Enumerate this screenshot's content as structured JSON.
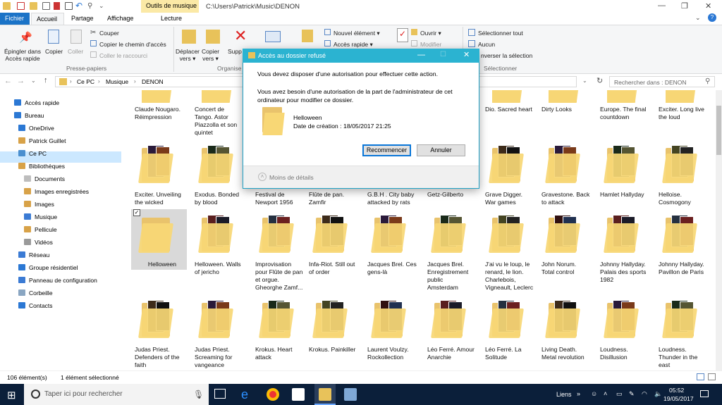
{
  "window": {
    "context_tab": "Outils de musique",
    "path_title": "C:\\Users\\Patrick\\Music\\DENON"
  },
  "tabs": [
    "Fichier",
    "Accueil",
    "Partage",
    "Affichage",
    "Lecture"
  ],
  "ribbon": {
    "pin": "Épingler dans\nAccès rapide",
    "copy": "Copier",
    "paste": "Coller",
    "cut": "Couper",
    "copy_path": "Copier le chemin d'accès",
    "paste_shortcut": "Coller le raccourci",
    "group_clipboard": "Presse-papiers",
    "move_to": "Déplacer\nvers ▾",
    "copy_to": "Copier\nvers ▾",
    "delete": "Supp",
    "group_organise": "Organise",
    "new_item": "Nouvel élément ▾",
    "easy_access": "Accès rapide ▾",
    "open": "Ouvrir ▾",
    "edit": "Modifier",
    "select_all": "Sélectionner tout",
    "select_none": "Aucun",
    "invert": "nverser la sélection",
    "group_select": "Sélectionner"
  },
  "address": {
    "crumbs": [
      "Ce PC",
      "Musique",
      "DENON"
    ],
    "search_placeholder": "Rechercher dans : DENON"
  },
  "nav": [
    {
      "label": "Accès rapide",
      "color": "#2b78d4"
    },
    {
      "label": "Bureau",
      "color": "#2b78d4"
    },
    {
      "label": "OneDrive",
      "color": "#2b78d4"
    },
    {
      "label": "Patrick Guillet",
      "color": "#d8a248"
    },
    {
      "label": "Ce PC",
      "color": "#4a8fcf"
    },
    {
      "label": "Bibliothèques",
      "color": "#d8a248"
    },
    {
      "label": "Documents",
      "color": "#bdbdbd"
    },
    {
      "label": "Images enregistrées",
      "color": "#d8a248"
    },
    {
      "label": "Images",
      "color": "#d8a248"
    },
    {
      "label": "Musique",
      "color": "#3b7bd4"
    },
    {
      "label": "Pellicule",
      "color": "#d8a248"
    },
    {
      "label": "Vidéos",
      "color": "#9a9a9a"
    },
    {
      "label": "Réseau",
      "color": "#3b7bd4"
    },
    {
      "label": "Groupe résidentiel",
      "color": "#2b78d4"
    },
    {
      "label": "Panneau de configuration",
      "color": "#3b7bd4"
    },
    {
      "label": "Corbeille",
      "color": "#8aa6c2"
    },
    {
      "label": "Contacts",
      "color": "#2b78d4"
    }
  ],
  "folders": {
    "row0": [
      "Claude Nougaro.\nRéimpression",
      "Concert de\nTango. Astor\nPiazzolla et son\nquintet",
      "",
      "",
      "",
      "",
      "Dio. Sacred heart",
      "Dirty Looks",
      "Europe. The final\ncountdown",
      "Exciter. Long live\nthe loud"
    ],
    "row1": [
      "Exciter. Unveiling\nthe wicked",
      "Exodus. Bonded\nby blood",
      "Festival de\nNewport 1956",
      "Flûte de pan.\nZamfir",
      "G.B.H . City baby\nattacked by rats",
      "Getz-Gilberto",
      "Grave Digger.\nWar games",
      "Gravestone. Back\nto attack",
      "Hamlet Hallyday",
      "Helloise.\nCosmogony"
    ],
    "row2": [
      "Helloween",
      "Helloween. Walls\nof jericho",
      "Improvisation\npour Flûte de pan\net orgue.\nGheorghe Zamf...",
      "Infa-Riot. Still out\nof order",
      "Jacques Brel. Ces\ngens-là",
      "Jacques Brel.\nEnregistrement\npublic\nAmsterdam",
      "J'ai vu le loup, le\nrenard, le lion.\nCharlebois,\nVigneault, Leclerc",
      "John Norum.\nTotal control",
      "Johnny Hallyday.\nPalais des sports\n1982",
      "Johnny Hallyday.\nPavillon de Paris"
    ],
    "row3": [
      "Judas Priest.\nDefenders of the\nfaith",
      "Judas Priest.\nScreaming for\nvangeance",
      "Krokus. Heart\nattack",
      "Krokus. Painkiller",
      "Laurent Voulzy.\nRockollection",
      "Léo Ferré. Amour\nAnarchie",
      "Léo Ferré. La\nSolitude",
      "Living Death.\nMetal revolution",
      "Loudness.\nDisillusion",
      "Loudness.\nThunder in the\neast"
    ]
  },
  "status": {
    "count": "106 élément(s)",
    "selected": "1 élément sélectionné"
  },
  "dialog": {
    "title": "Accès au dossier refusé",
    "line1": "Vous devez disposer d'une autorisation pour effectuer cette action.",
    "line2": "Vous avez besoin d'une autorisation de la part de l'administrateur de cet\nordinateur pour modifier ce dossier.",
    "folder_name": "Helloween",
    "created": "Date de création : 18/05/2017 21:25",
    "retry": "Recommencer",
    "cancel": "Annuler",
    "less_details": "Moins de détails"
  },
  "taskbar": {
    "search_placeholder": "Taper ici pour rechercher",
    "links": "Liens",
    "time": "05:52",
    "date": "19/05/2017"
  },
  "colors": {
    "accent": "#1a73c7",
    "dialog_title": "#2bb3d1",
    "taskbar": "#0b1f3a",
    "folder": "#f8d775"
  }
}
